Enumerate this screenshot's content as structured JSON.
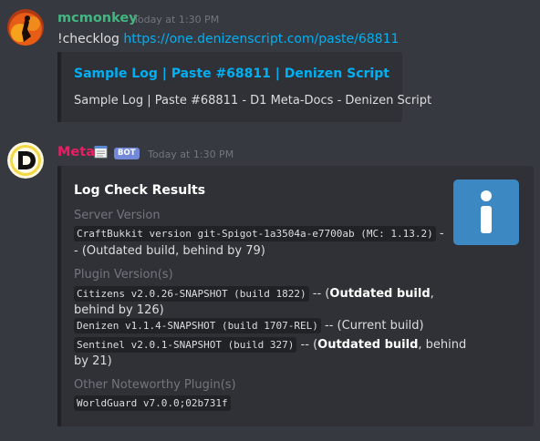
{
  "messages": [
    {
      "author": "mcmonkey",
      "timestamp": "Today at 1:30 PM",
      "text_prefix": "!checklog ",
      "link": "https://one.denizenscript.com/paste/68811",
      "embed": {
        "title": "Sample Log | Paste #68811 | Denizen Script",
        "description": "Sample Log | Paste #68811 - D1 Meta-Docs - Denizen Script"
      }
    },
    {
      "author": "Meta",
      "badge": "BOT",
      "timestamp": "Today at 1:30 PM",
      "embed": {
        "title": "Log Check Results",
        "thumbnail_icon": "info-icon",
        "fields": [
          {
            "name": "Server Version",
            "lines": [
              {
                "code": "CraftBukkit version git-Spigot-1a3504a-e7700ab (MC: 1.13.2)",
                "after": " -"
              },
              {
                "text": "- (Outdated build, behind by 79)"
              }
            ]
          },
          {
            "name": "Plugin Version(s)",
            "entries": [
              {
                "code": "Citizens v2.0.26-SNAPSHOT (build 1822)",
                "pre": " -- (",
                "bold": "Outdated build",
                "post": ",",
                "cont": "behind by 126)"
              },
              {
                "code": "Denizen v1.1.4-SNAPSHOT (build 1707-REL)",
                "pre": " -- (Current build)"
              },
              {
                "code": "Sentinel v2.0.1-SNAPSHOT (build 327)",
                "pre": " -- (",
                "bold": "Outdated build",
                "post": ", behind",
                "cont": "by 21)"
              }
            ]
          },
          {
            "name": "Other Noteworthy Plugin(s)",
            "code": "WorldGuard v7.0.0;02b731f"
          }
        ]
      }
    }
  ],
  "colors": {
    "background": "#36393f",
    "embed_bg": "#2f3136",
    "link": "#00b0f4",
    "mcmonkey_name": "#43b581",
    "meta_name": "#e91e63",
    "bot_badge": "#7289da",
    "info_thumb": "#3b88c3"
  }
}
